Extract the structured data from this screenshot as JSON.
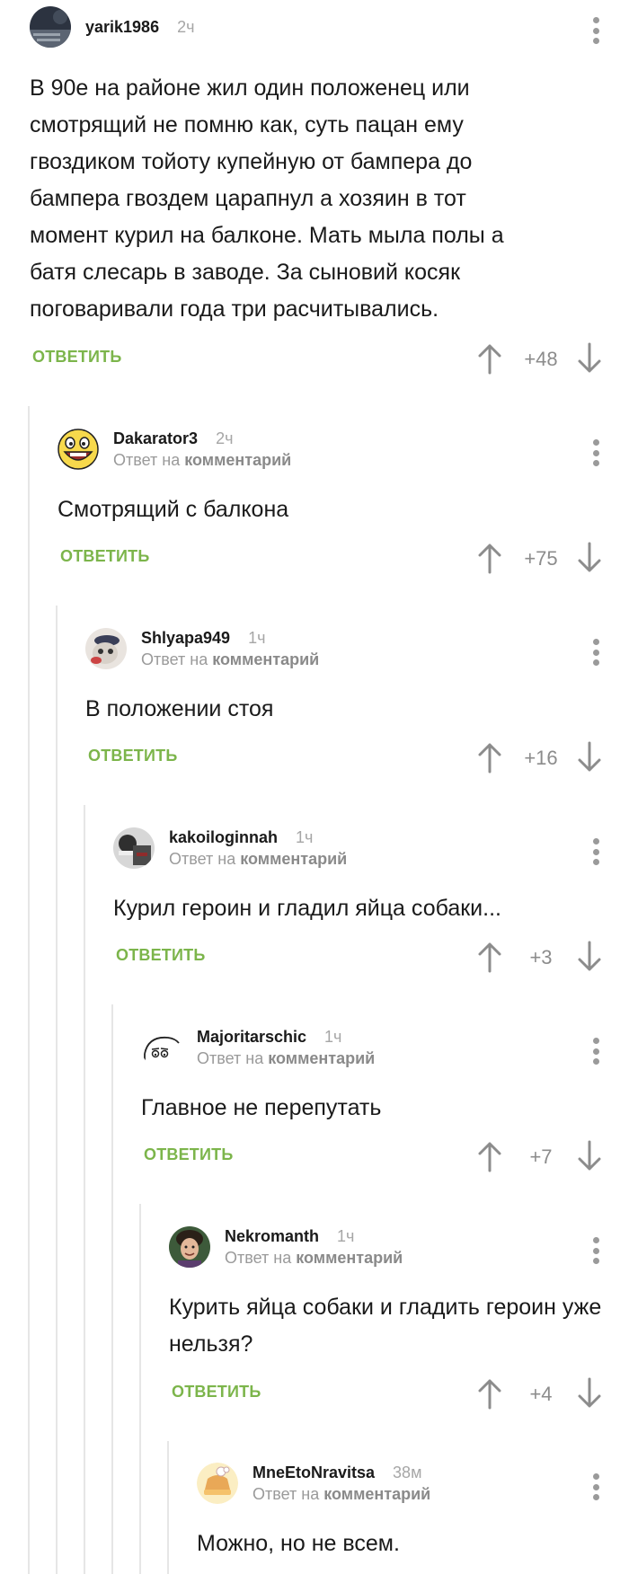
{
  "ui": {
    "reply_label": "ОТВЕТИТЬ",
    "reply_to_prefix": "Ответ на",
    "reply_to_target": "комментарий"
  },
  "comments": [
    {
      "username": "yarik1986",
      "time": "2ч",
      "text": "В 90е на районе жил один положенец или смотрящий не помню как, суть пацан ему гвоздиком тойоту купейную от бампера до бампера гвоздем царапнул а хозяин в тот момент курил на балконе. Мать мыла полы а батя слесарь в заводе. За сыновий косяк поговаривали года три расчитывались.",
      "score": "+48"
    },
    {
      "username": "Dakarator3",
      "time": "2ч",
      "text": "Смотрящий с балкона",
      "score": "+75"
    },
    {
      "username": "Shlyapa949",
      "time": "1ч",
      "text": "В положении стоя",
      "score": "+16"
    },
    {
      "username": "kakoiloginnah",
      "time": "1ч",
      "text": "Курил героин и гладил яйца собаки...",
      "score": "+3"
    },
    {
      "username": "Majoritarschic",
      "time": "1ч",
      "text": "Главное не перепутать",
      "score": "+7"
    },
    {
      "username": "Nekromanth",
      "time": "1ч",
      "text": "Курить яйца собаки и гладить героин уже нельзя?",
      "score": "+4"
    },
    {
      "username": "MneEtoNravitsa",
      "time": "38м",
      "text": "Можно, но не всем.",
      "score": ""
    }
  ],
  "colors": {
    "accent": "#7cb54b",
    "muted": "#9a9a9a",
    "thread_line": "#e6e6e6"
  },
  "icons": [
    "more-vertical-icon",
    "arrow-up-icon",
    "arrow-down-icon"
  ]
}
